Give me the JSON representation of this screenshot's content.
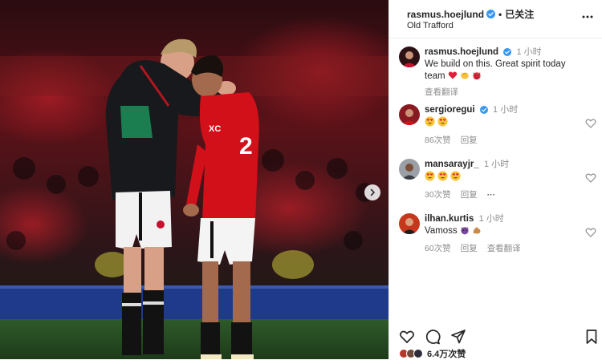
{
  "post": {
    "username": "rasmus.hoejlund",
    "follow_status": "已关注",
    "location": "Old Trafford",
    "caption_time": "1 小时",
    "caption_text": "We build on this. Great spirit today team",
    "caption_translate": "查看翻译"
  },
  "comments": [
    {
      "username": "sergioregui",
      "time": "1 小时",
      "likes": "86次赞",
      "reply": "回复",
      "verified": true,
      "emojis": [
        "heart-eyes-emoji",
        "heart-eyes-emoji"
      ]
    },
    {
      "username": "mansarayjr_",
      "time": "1 小时",
      "likes": "30次赞",
      "reply": "回复",
      "more": "···",
      "emojis": [
        "heart-eyes-emoji",
        "heart-eyes-emoji",
        "heart-eyes-emoji"
      ]
    },
    {
      "username": "ilhan.kurtis",
      "time": "1 小时",
      "text": "Vamoss",
      "likes": "60次赞",
      "reply": "回复",
      "translate": "查看翻译",
      "emojis": [
        "devil-emoji",
        "muscle-emoji"
      ]
    }
  ],
  "footer": {
    "likes_count": "6.4万次赞"
  },
  "colors": {
    "verified": "#3897f0",
    "meta_text": "#8e8e8e",
    "united_red": "#d2101a"
  }
}
